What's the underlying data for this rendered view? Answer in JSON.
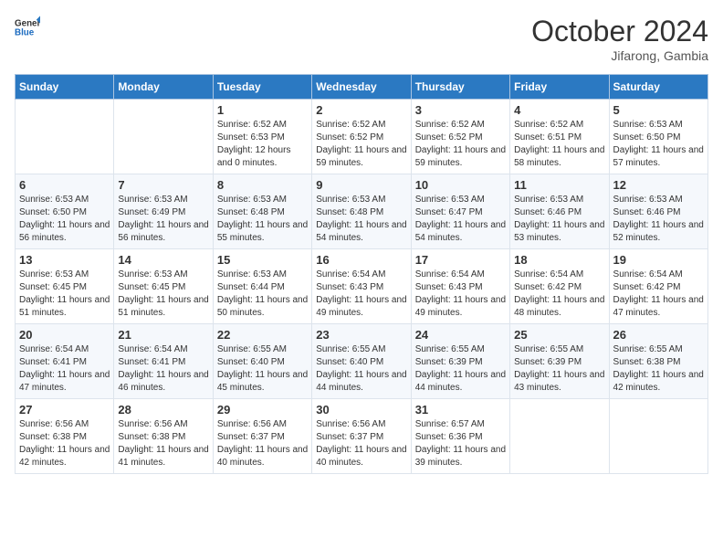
{
  "header": {
    "logo_general": "General",
    "logo_blue": "Blue",
    "month": "October 2024",
    "location": "Jifarong, Gambia"
  },
  "days_of_week": [
    "Sunday",
    "Monday",
    "Tuesday",
    "Wednesday",
    "Thursday",
    "Friday",
    "Saturday"
  ],
  "weeks": [
    [
      {
        "day": "",
        "sunrise": "",
        "sunset": "",
        "daylight": ""
      },
      {
        "day": "",
        "sunrise": "",
        "sunset": "",
        "daylight": ""
      },
      {
        "day": "1",
        "sunrise": "Sunrise: 6:52 AM",
        "sunset": "Sunset: 6:53 PM",
        "daylight": "Daylight: 12 hours and 0 minutes."
      },
      {
        "day": "2",
        "sunrise": "Sunrise: 6:52 AM",
        "sunset": "Sunset: 6:52 PM",
        "daylight": "Daylight: 11 hours and 59 minutes."
      },
      {
        "day": "3",
        "sunrise": "Sunrise: 6:52 AM",
        "sunset": "Sunset: 6:52 PM",
        "daylight": "Daylight: 11 hours and 59 minutes."
      },
      {
        "day": "4",
        "sunrise": "Sunrise: 6:52 AM",
        "sunset": "Sunset: 6:51 PM",
        "daylight": "Daylight: 11 hours and 58 minutes."
      },
      {
        "day": "5",
        "sunrise": "Sunrise: 6:53 AM",
        "sunset": "Sunset: 6:50 PM",
        "daylight": "Daylight: 11 hours and 57 minutes."
      }
    ],
    [
      {
        "day": "6",
        "sunrise": "Sunrise: 6:53 AM",
        "sunset": "Sunset: 6:50 PM",
        "daylight": "Daylight: 11 hours and 56 minutes."
      },
      {
        "day": "7",
        "sunrise": "Sunrise: 6:53 AM",
        "sunset": "Sunset: 6:49 PM",
        "daylight": "Daylight: 11 hours and 56 minutes."
      },
      {
        "day": "8",
        "sunrise": "Sunrise: 6:53 AM",
        "sunset": "Sunset: 6:48 PM",
        "daylight": "Daylight: 11 hours and 55 minutes."
      },
      {
        "day": "9",
        "sunrise": "Sunrise: 6:53 AM",
        "sunset": "Sunset: 6:48 PM",
        "daylight": "Daylight: 11 hours and 54 minutes."
      },
      {
        "day": "10",
        "sunrise": "Sunrise: 6:53 AM",
        "sunset": "Sunset: 6:47 PM",
        "daylight": "Daylight: 11 hours and 54 minutes."
      },
      {
        "day": "11",
        "sunrise": "Sunrise: 6:53 AM",
        "sunset": "Sunset: 6:46 PM",
        "daylight": "Daylight: 11 hours and 53 minutes."
      },
      {
        "day": "12",
        "sunrise": "Sunrise: 6:53 AM",
        "sunset": "Sunset: 6:46 PM",
        "daylight": "Daylight: 11 hours and 52 minutes."
      }
    ],
    [
      {
        "day": "13",
        "sunrise": "Sunrise: 6:53 AM",
        "sunset": "Sunset: 6:45 PM",
        "daylight": "Daylight: 11 hours and 51 minutes."
      },
      {
        "day": "14",
        "sunrise": "Sunrise: 6:53 AM",
        "sunset": "Sunset: 6:45 PM",
        "daylight": "Daylight: 11 hours and 51 minutes."
      },
      {
        "day": "15",
        "sunrise": "Sunrise: 6:53 AM",
        "sunset": "Sunset: 6:44 PM",
        "daylight": "Daylight: 11 hours and 50 minutes."
      },
      {
        "day": "16",
        "sunrise": "Sunrise: 6:54 AM",
        "sunset": "Sunset: 6:43 PM",
        "daylight": "Daylight: 11 hours and 49 minutes."
      },
      {
        "day": "17",
        "sunrise": "Sunrise: 6:54 AM",
        "sunset": "Sunset: 6:43 PM",
        "daylight": "Daylight: 11 hours and 49 minutes."
      },
      {
        "day": "18",
        "sunrise": "Sunrise: 6:54 AM",
        "sunset": "Sunset: 6:42 PM",
        "daylight": "Daylight: 11 hours and 48 minutes."
      },
      {
        "day": "19",
        "sunrise": "Sunrise: 6:54 AM",
        "sunset": "Sunset: 6:42 PM",
        "daylight": "Daylight: 11 hours and 47 minutes."
      }
    ],
    [
      {
        "day": "20",
        "sunrise": "Sunrise: 6:54 AM",
        "sunset": "Sunset: 6:41 PM",
        "daylight": "Daylight: 11 hours and 47 minutes."
      },
      {
        "day": "21",
        "sunrise": "Sunrise: 6:54 AM",
        "sunset": "Sunset: 6:41 PM",
        "daylight": "Daylight: 11 hours and 46 minutes."
      },
      {
        "day": "22",
        "sunrise": "Sunrise: 6:55 AM",
        "sunset": "Sunset: 6:40 PM",
        "daylight": "Daylight: 11 hours and 45 minutes."
      },
      {
        "day": "23",
        "sunrise": "Sunrise: 6:55 AM",
        "sunset": "Sunset: 6:40 PM",
        "daylight": "Daylight: 11 hours and 44 minutes."
      },
      {
        "day": "24",
        "sunrise": "Sunrise: 6:55 AM",
        "sunset": "Sunset: 6:39 PM",
        "daylight": "Daylight: 11 hours and 44 minutes."
      },
      {
        "day": "25",
        "sunrise": "Sunrise: 6:55 AM",
        "sunset": "Sunset: 6:39 PM",
        "daylight": "Daylight: 11 hours and 43 minutes."
      },
      {
        "day": "26",
        "sunrise": "Sunrise: 6:55 AM",
        "sunset": "Sunset: 6:38 PM",
        "daylight": "Daylight: 11 hours and 42 minutes."
      }
    ],
    [
      {
        "day": "27",
        "sunrise": "Sunrise: 6:56 AM",
        "sunset": "Sunset: 6:38 PM",
        "daylight": "Daylight: 11 hours and 42 minutes."
      },
      {
        "day": "28",
        "sunrise": "Sunrise: 6:56 AM",
        "sunset": "Sunset: 6:38 PM",
        "daylight": "Daylight: 11 hours and 41 minutes."
      },
      {
        "day": "29",
        "sunrise": "Sunrise: 6:56 AM",
        "sunset": "Sunset: 6:37 PM",
        "daylight": "Daylight: 11 hours and 40 minutes."
      },
      {
        "day": "30",
        "sunrise": "Sunrise: 6:56 AM",
        "sunset": "Sunset: 6:37 PM",
        "daylight": "Daylight: 11 hours and 40 minutes."
      },
      {
        "day": "31",
        "sunrise": "Sunrise: 6:57 AM",
        "sunset": "Sunset: 6:36 PM",
        "daylight": "Daylight: 11 hours and 39 minutes."
      },
      {
        "day": "",
        "sunrise": "",
        "sunset": "",
        "daylight": ""
      },
      {
        "day": "",
        "sunrise": "",
        "sunset": "",
        "daylight": ""
      }
    ]
  ]
}
